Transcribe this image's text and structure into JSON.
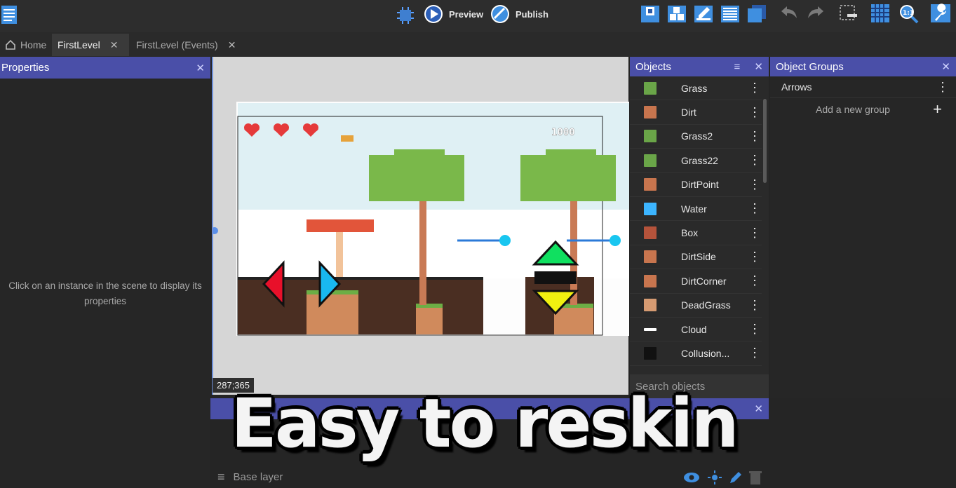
{
  "toolbar": {
    "preview_label": "Preview",
    "publish_label": "Publish"
  },
  "tabs": [
    {
      "label": "Home"
    },
    {
      "label": "FirstLevel"
    },
    {
      "label": "FirstLevel (Events)"
    }
  ],
  "properties": {
    "title": "Properties",
    "empty_message": "Click on an instance in the scene to display its properties"
  },
  "scene": {
    "cursor_coords": "287;365",
    "score_text": "1000"
  },
  "objects": {
    "title": "Objects",
    "items": [
      {
        "name": "Grass",
        "color": "#6aa548"
      },
      {
        "name": "Dirt",
        "color": "#c8754e"
      },
      {
        "name": "Grass2",
        "color": "#6aa548"
      },
      {
        "name": "Grass22",
        "color": "#6aa548"
      },
      {
        "name": "DirtPoint",
        "color": "#c8754e"
      },
      {
        "name": "Water",
        "color": "#3cb5ff"
      },
      {
        "name": "Box",
        "color": "#b5533b"
      },
      {
        "name": "DirtSide",
        "color": "#c8754e"
      },
      {
        "name": "DirtCorner",
        "color": "#c8754e"
      },
      {
        "name": "DeadGrass",
        "color": "#d69b72"
      },
      {
        "name": "Cloud",
        "color": "#ffffff"
      },
      {
        "name": "Collusion...",
        "color": "#111111"
      }
    ],
    "search_placeholder": "Search objects"
  },
  "object_groups": {
    "title": "Object Groups",
    "items": [
      {
        "name": "Arrows"
      }
    ],
    "add_label": "Add a new group"
  },
  "layers": {
    "title": "rs",
    "base_layer": "Base layer"
  },
  "overlay": {
    "caption": "Easy to reskin"
  }
}
